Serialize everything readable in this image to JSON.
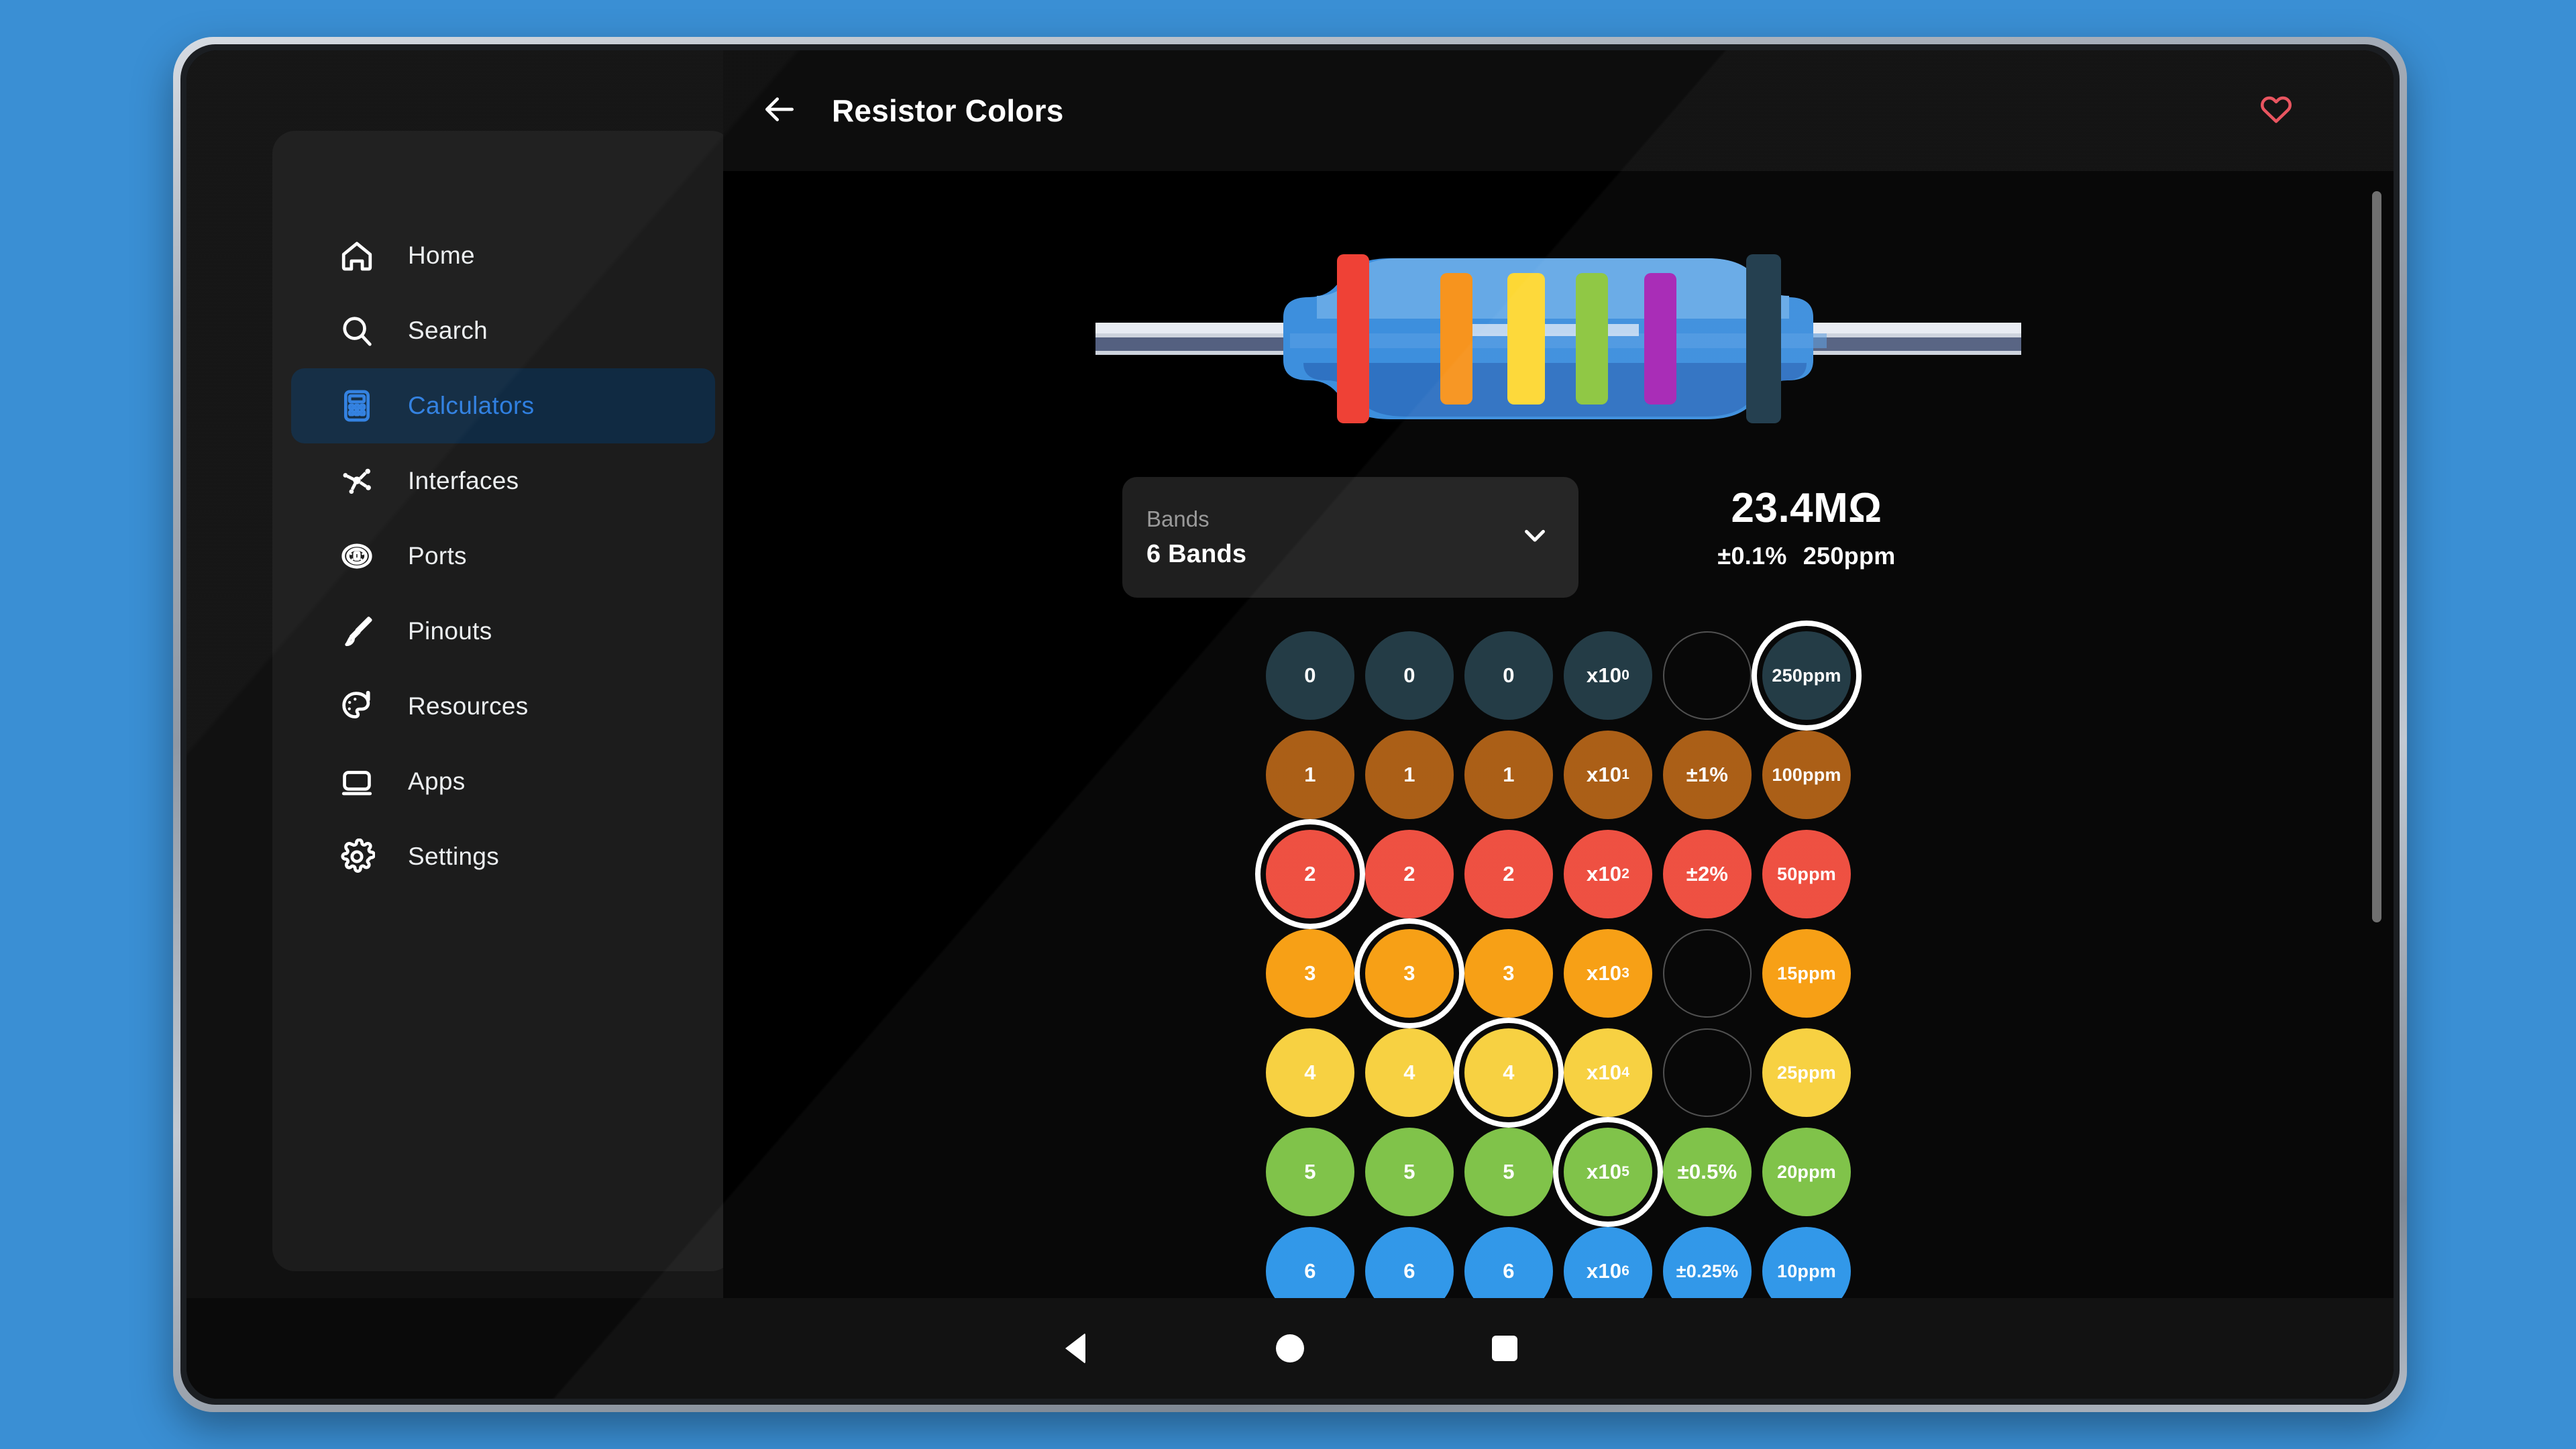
{
  "device": {
    "frame_color": "#aab2bd",
    "screen_bg": "#0a0a0a"
  },
  "sidebar": {
    "items": [
      {
        "label": "Home",
        "icon": "home-icon",
        "active": false
      },
      {
        "label": "Search",
        "icon": "search-icon",
        "active": false
      },
      {
        "label": "Calculators",
        "icon": "calculator-icon",
        "active": true
      },
      {
        "label": "Interfaces",
        "icon": "interfaces-icon",
        "active": false
      },
      {
        "label": "Ports",
        "icon": "ports-icon",
        "active": false
      },
      {
        "label": "Pinouts",
        "icon": "pinouts-icon",
        "active": false
      },
      {
        "label": "Resources",
        "icon": "palette-icon",
        "active": false
      },
      {
        "label": "Apps",
        "icon": "apps-icon",
        "active": false
      },
      {
        "label": "Settings",
        "icon": "gear-icon",
        "active": false
      }
    ],
    "active_color": "#2f7fe0",
    "active_bg": "#102a42"
  },
  "topbar": {
    "back_icon": "arrow-left-icon",
    "title": "Resistor Colors",
    "favorite_icon": "heart-icon",
    "favorite_color": "#e8505b"
  },
  "bands_select": {
    "label": "Bands",
    "value": "6 Bands",
    "chevron_icon": "chevron-down-icon"
  },
  "readout": {
    "value": "23.4MΩ",
    "tolerance": "±0.1%",
    "tempco": "250ppm"
  },
  "resistor": {
    "body_color": "#3d8fdd",
    "lead_color": "#cdd3dd",
    "bands": [
      "#ef4136",
      "#f7941e",
      "#fdd835",
      "#8cc63f",
      "#a626b5",
      "#1e3a4a"
    ]
  },
  "grid": {
    "selected": {
      "0": 5,
      "2": 0,
      "3": 1,
      "4": 2,
      "5": 3
    },
    "rows": [
      {
        "name": "black",
        "color": "#1d3640",
        "cells": [
          {
            "text": "0",
            "empty": false,
            "selected": false
          },
          {
            "text": "0",
            "empty": false,
            "selected": false
          },
          {
            "text": "0",
            "empty": false,
            "selected": false
          },
          {
            "text": "x10",
            "sup": "0",
            "empty": false,
            "selected": false
          },
          {
            "text": "",
            "empty": true,
            "selected": false
          },
          {
            "text": "250ppm",
            "small": true,
            "empty": false,
            "selected": true
          }
        ]
      },
      {
        "name": "brown",
        "color": "#a85a10",
        "cells": [
          {
            "text": "1",
            "empty": false,
            "selected": false
          },
          {
            "text": "1",
            "empty": false,
            "selected": false
          },
          {
            "text": "1",
            "empty": false,
            "selected": false
          },
          {
            "text": "x10",
            "sup": "1",
            "empty": false,
            "selected": false
          },
          {
            "text": "±1%",
            "empty": false,
            "selected": false
          },
          {
            "text": "100ppm",
            "small": true,
            "empty": false,
            "selected": false
          }
        ]
      },
      {
        "name": "red",
        "color": "#ee4b3c",
        "cells": [
          {
            "text": "2",
            "empty": false,
            "selected": true
          },
          {
            "text": "2",
            "empty": false,
            "selected": false
          },
          {
            "text": "2",
            "empty": false,
            "selected": false
          },
          {
            "text": "x10",
            "sup": "2",
            "empty": false,
            "selected": false
          },
          {
            "text": "±2%",
            "empty": false,
            "selected": false
          },
          {
            "text": "50ppm",
            "small": true,
            "empty": false,
            "selected": false
          }
        ]
      },
      {
        "name": "orange",
        "color": "#f79d0e",
        "cells": [
          {
            "text": "3",
            "empty": false,
            "selected": false
          },
          {
            "text": "3",
            "empty": false,
            "selected": true
          },
          {
            "text": "3",
            "empty": false,
            "selected": false
          },
          {
            "text": "x10",
            "sup": "3",
            "empty": false,
            "selected": false
          },
          {
            "text": "",
            "empty": true,
            "selected": false
          },
          {
            "text": "15ppm",
            "small": true,
            "empty": false,
            "selected": false
          }
        ]
      },
      {
        "name": "yellow",
        "color": "#f7d03c",
        "cells": [
          {
            "text": "4",
            "empty": false,
            "selected": false
          },
          {
            "text": "4",
            "empty": false,
            "selected": false
          },
          {
            "text": "4",
            "empty": false,
            "selected": true
          },
          {
            "text": "x10",
            "sup": "4",
            "empty": false,
            "selected": false
          },
          {
            "text": "",
            "empty": true,
            "selected": false
          },
          {
            "text": "25ppm",
            "small": true,
            "empty": false,
            "selected": false
          }
        ]
      },
      {
        "name": "green",
        "color": "#7cc144",
        "cells": [
          {
            "text": "5",
            "empty": false,
            "selected": false
          },
          {
            "text": "5",
            "empty": false,
            "selected": false
          },
          {
            "text": "5",
            "empty": false,
            "selected": false
          },
          {
            "text": "x10",
            "sup": "5",
            "empty": false,
            "selected": true
          },
          {
            "text": "±0.5%",
            "empty": false,
            "selected": false
          },
          {
            "text": "20ppm",
            "small": true,
            "empty": false,
            "selected": false
          }
        ]
      },
      {
        "name": "blue",
        "color": "#2b95e8",
        "cells": [
          {
            "text": "6",
            "empty": false,
            "selected": false
          },
          {
            "text": "6",
            "empty": false,
            "selected": false
          },
          {
            "text": "6",
            "empty": false,
            "selected": false
          },
          {
            "text": "x10",
            "sup": "6",
            "empty": false,
            "selected": false
          },
          {
            "text": "±0.25%",
            "small": true,
            "empty": false,
            "selected": false
          },
          {
            "text": "10ppm",
            "small": true,
            "empty": false,
            "selected": false
          }
        ]
      }
    ]
  },
  "navbar": {
    "back": "nav-back-icon",
    "home": "nav-home-icon",
    "recent": "nav-recent-icon"
  },
  "scrollbar": {
    "present": true
  }
}
